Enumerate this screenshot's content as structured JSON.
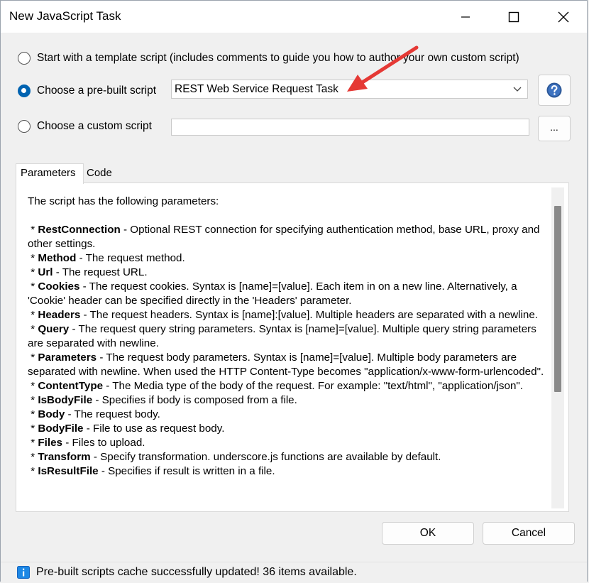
{
  "window": {
    "title": "New JavaScript Task"
  },
  "options": {
    "template_label": "Start with a template script (includes comments to guide you how to author your own custom script)",
    "prebuilt_label": "Choose a pre-built script",
    "custom_label": "Choose a custom script",
    "selected": "prebuilt",
    "prebuilt_value": "REST Web Service Request Task",
    "custom_value": "",
    "browse_label": "..."
  },
  "tabs": {
    "parameters": "Parameters",
    "code": "Code",
    "active": "parameters"
  },
  "description": {
    "intro": "The script has the following parameters:",
    "params": [
      {
        "name": "RestConnection",
        "text": " - Optional REST connection for specifying authentication method, base URL, proxy and other settings."
      },
      {
        "name": "Method",
        "text": " - The request method."
      },
      {
        "name": "Url",
        "text": " - The request URL."
      },
      {
        "name": "Cookies",
        "text": " - The request cookies. Syntax is [name]=[value]. Each item in on a new line. Alternatively, a 'Cookie' header can be specified directly in the 'Headers' parameter."
      },
      {
        "name": "Headers",
        "text": " - The request headers. Syntax is [name]:[value]. Multiple headers are separated with a newline."
      },
      {
        "name": "Query",
        "text": " - The request query string parameters. Syntax is [name]=[value]. Multiple query string parameters are separated with newline."
      },
      {
        "name": "Parameters",
        "text": " - The request body parameters. Syntax is [name]=[value]. Multiple body parameters are separated with newline. When used the HTTP Content-Type becomes \"application/x-www-form-urlencoded\"."
      },
      {
        "name": "ContentType",
        "text": " - The Media type of the body of the request. For example: \"text/html\", \"application/json\"."
      },
      {
        "name": "IsBodyFile",
        "text": " - Specifies if body is composed from a file."
      },
      {
        "name": "Body",
        "text": " - The request body."
      },
      {
        "name": "BodyFile",
        "text": " - File to use as request body."
      },
      {
        "name": "Files",
        "text": " - Files to upload."
      },
      {
        "name": "Transform",
        "text": " - Specify transformation. underscore.js functions are available by default."
      },
      {
        "name": "IsResultFile",
        "text": " - Specifies if result is written in a file."
      }
    ]
  },
  "buttons": {
    "ok": "OK",
    "cancel": "Cancel"
  },
  "status": {
    "text": "Pre-built scripts cache successfully updated! 36 items available."
  },
  "colors": {
    "accent": "#0063b1",
    "annotation_arrow": "#e53935",
    "help_icon": "#2b5797",
    "info_icon": "#1e88e5"
  }
}
